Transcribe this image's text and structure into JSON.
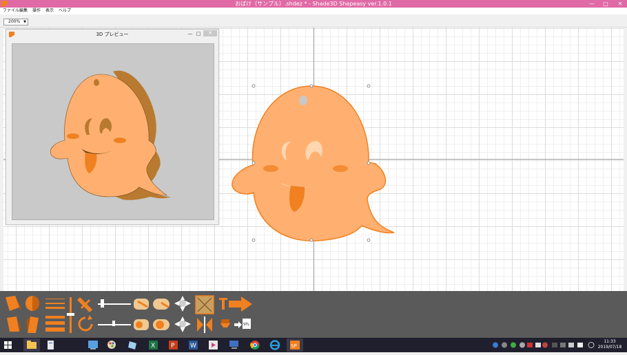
{
  "window": {
    "title": "おばけ（サンプル）.shdez *  - Shade3D Shapeasy ver.1.0.1",
    "minimize": "—",
    "maximize": "□",
    "close": "✕"
  },
  "menu": {
    "items": [
      "ファイル",
      "編集",
      "操作",
      "表示",
      "ヘルプ"
    ]
  },
  "zoom": {
    "value": "200%"
  },
  "preview": {
    "title": "3D プレビュー",
    "minimize": "—",
    "maximize": "□",
    "close": "✕"
  },
  "colors": {
    "title_bar": "#e06aa6",
    "ghost_fill": "#ffb070",
    "ghost_stroke": "#f08020",
    "ghost_side": "#b87a30",
    "tool_panel": "#5a5a5a",
    "tool_orange": "#f08020"
  },
  "taskbar": {
    "apps": [
      "start-icon",
      "file-explorer-icon",
      "document-icon",
      "control-panel-icon",
      "paint-icon",
      "app-icon",
      "excel-icon",
      "powerpoint-icon",
      "word-icon",
      "media-icon",
      "pc-icon",
      "chrome-icon",
      "ie-icon",
      "shapeasy-icon"
    ],
    "time": "11:33",
    "date": "2019/07/18"
  }
}
